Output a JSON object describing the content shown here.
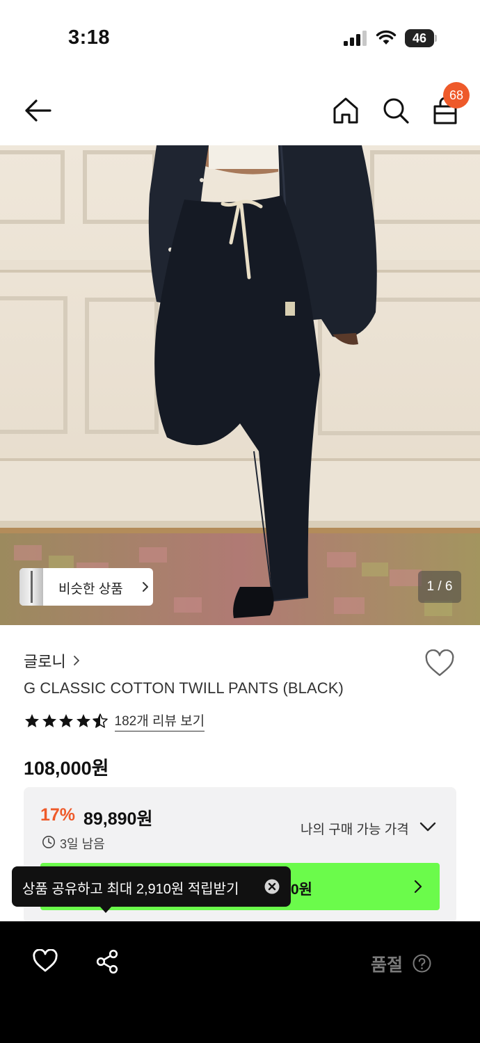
{
  "status_bar": {
    "time": "3:18",
    "battery": "46"
  },
  "nav": {
    "cart_count": "68"
  },
  "gallery": {
    "similar_label": "비슷한 상품",
    "page_counter": "1 / 6"
  },
  "product": {
    "brand": "글로니",
    "title": "G CLASSIC COTTON TWILL PANTS (BLACK)",
    "rating": 4.5,
    "review_link": "182개 리뷰 보기",
    "original_price": "108,000원"
  },
  "price_box": {
    "discount": "17%",
    "sale_price": "89,890원",
    "time_left": "3일 남음",
    "my_price_label": "나의 구매 가능 가격",
    "coupon_price_partial": "0원"
  },
  "tooltip": {
    "text": "상품 공유하고 최대 2,910원 적립받기"
  },
  "bottom_bar": {
    "soldout_label": "품절"
  },
  "colors": {
    "accent_orange": "#ee5a2a",
    "coupon_green": "#6bfb4b",
    "bottom_bar": "#000000"
  }
}
